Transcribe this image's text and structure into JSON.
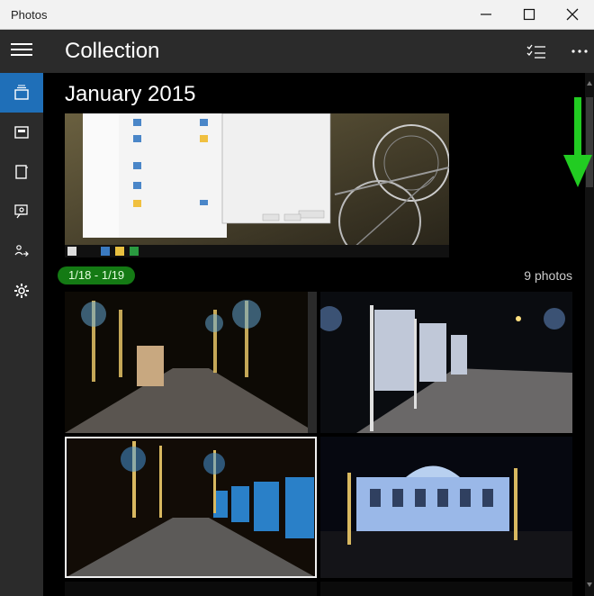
{
  "window": {
    "title": "Photos"
  },
  "header": {
    "title": "Collection"
  },
  "nav": [
    {
      "icon": "collection-icon",
      "active": true
    },
    {
      "icon": "albums-icon"
    },
    {
      "icon": "folders-icon"
    },
    {
      "icon": "people-icon"
    },
    {
      "icon": "import-icon"
    },
    {
      "icon": "settings-icon"
    }
  ],
  "content": {
    "month_label": "January 2015",
    "date_range": "1/18 - 1/19",
    "photo_count": "9 photos"
  },
  "colors": {
    "accent": "#1f6fb8",
    "badge": "#147a14",
    "rail": "#2b2b2b"
  }
}
